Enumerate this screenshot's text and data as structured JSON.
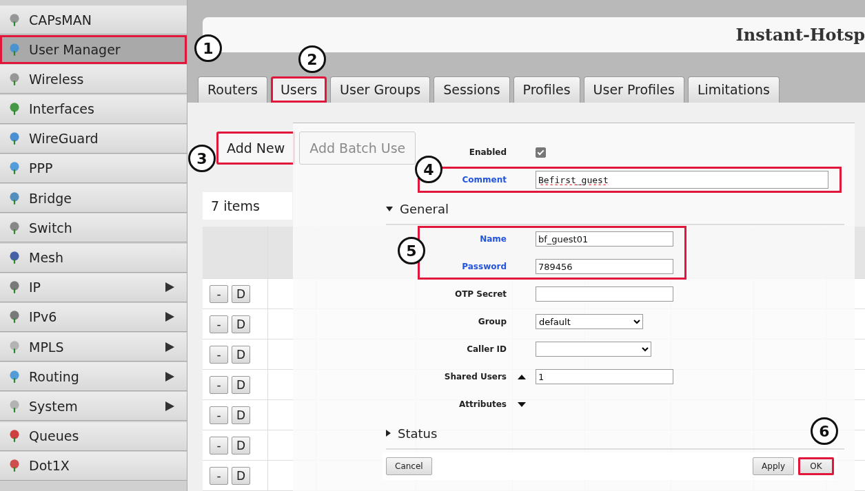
{
  "sidebar": {
    "items": [
      {
        "label": "CAPsMAN",
        "selected": false,
        "marked": false,
        "submenu": false
      },
      {
        "label": "User Manager",
        "selected": true,
        "marked": true,
        "submenu": false
      },
      {
        "label": "Wireless",
        "selected": false,
        "marked": false,
        "submenu": false
      },
      {
        "label": "Interfaces",
        "selected": false,
        "marked": false,
        "submenu": false
      },
      {
        "label": "WireGuard",
        "selected": false,
        "marked": false,
        "submenu": false
      },
      {
        "label": "PPP",
        "selected": false,
        "marked": false,
        "submenu": false
      },
      {
        "label": "Bridge",
        "selected": false,
        "marked": false,
        "submenu": false
      },
      {
        "label": "Switch",
        "selected": false,
        "marked": false,
        "submenu": false
      },
      {
        "label": "Mesh",
        "selected": false,
        "marked": false,
        "submenu": false
      },
      {
        "label": "IP",
        "selected": false,
        "marked": false,
        "submenu": true
      },
      {
        "label": "IPv6",
        "selected": false,
        "marked": false,
        "submenu": true
      },
      {
        "label": "MPLS",
        "selected": false,
        "marked": false,
        "submenu": true
      },
      {
        "label": "Routing",
        "selected": false,
        "marked": false,
        "submenu": true
      },
      {
        "label": "System",
        "selected": false,
        "marked": false,
        "submenu": true
      },
      {
        "label": "Queues",
        "selected": false,
        "marked": false,
        "submenu": false
      },
      {
        "label": "Dot1X",
        "selected": false,
        "marked": false,
        "submenu": false
      }
    ]
  },
  "header": {
    "title": "Instant-Hotsp"
  },
  "tabs": [
    {
      "label": "Routers",
      "selected": false,
      "marked": false
    },
    {
      "label": "Users",
      "selected": true,
      "marked": true
    },
    {
      "label": "User Groups",
      "selected": false,
      "marked": false
    },
    {
      "label": "Sessions",
      "selected": false,
      "marked": false
    },
    {
      "label": "Profiles",
      "selected": false,
      "marked": false
    },
    {
      "label": "User Profiles",
      "selected": false,
      "marked": false
    },
    {
      "label": "Limitations",
      "selected": false,
      "marked": false
    }
  ],
  "toolbar": [
    {
      "label": "Add New",
      "marked": true
    },
    {
      "label": "Add Batch Use",
      "marked": false
    }
  ],
  "item_count": "7 items",
  "table": {
    "rows": [
      {
        "actions": [
          "-",
          "D"
        ]
      },
      {
        "actions": [
          "-",
          "D"
        ]
      },
      {
        "actions": [
          "-",
          "D"
        ]
      },
      {
        "actions": [
          "-",
          "D"
        ]
      },
      {
        "actions": [
          "-",
          "D"
        ]
      },
      {
        "actions": [
          "-",
          "D"
        ]
      },
      {
        "actions": [
          "-",
          "D"
        ]
      }
    ]
  },
  "dialog": {
    "items": [
      {
        "kind": "group",
        "marked": false,
        "rows": [
          {
            "kind": "checkbox",
            "label": "Enabled",
            "required": false,
            "checked": true
          }
        ]
      },
      {
        "kind": "group",
        "marked": true,
        "rows": [
          {
            "kind": "textarea",
            "label": "Comment",
            "required": true,
            "value": "Befirst_guest"
          }
        ]
      },
      {
        "kind": "section",
        "label": "General",
        "expanded": true
      },
      {
        "kind": "group",
        "marked": true,
        "rows": [
          {
            "kind": "text",
            "label": "Name",
            "required": true,
            "value": "bf_guest01"
          },
          {
            "kind": "text",
            "label": "Password",
            "required": true,
            "value": "789456"
          }
        ]
      },
      {
        "kind": "group",
        "marked": false,
        "rows": [
          {
            "kind": "text",
            "label": "OTP Secret",
            "required": false,
            "value": ""
          },
          {
            "kind": "select",
            "label": "Group",
            "required": false,
            "value": "default"
          },
          {
            "kind": "select",
            "label": "Caller ID",
            "required": false,
            "value": ""
          },
          {
            "kind": "spinner",
            "label": "Shared Users",
            "required": false,
            "value": "1",
            "expanded": true
          },
          {
            "kind": "toggle",
            "label": "Attributes",
            "required": false,
            "expanded": false
          }
        ]
      },
      {
        "kind": "section",
        "label": "Status",
        "expanded": false
      }
    ],
    "buttons": [
      {
        "label": "Cancel",
        "marked": false
      },
      {
        "label": "Apply",
        "marked": false
      },
      {
        "label": "OK",
        "marked": true
      }
    ]
  },
  "annotations": [
    "1",
    "2",
    "3",
    "4",
    "5",
    "6"
  ]
}
